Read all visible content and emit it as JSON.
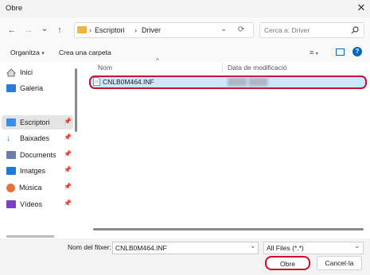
{
  "window": {
    "title": "Obre"
  },
  "nav": {
    "back": "←",
    "forward": "→",
    "recent": "⌄",
    "up": "↑",
    "breadcrumb": [
      "Escriptori",
      "Driver"
    ],
    "sep": "›",
    "refresh": "⟳",
    "search_placeholder": "Cerca a: Driver"
  },
  "toolbar": {
    "organize": "Organitza",
    "new_folder": "Crea una carpeta"
  },
  "sidebar": {
    "items": [
      {
        "label": "Inici",
        "icon": "home-icon"
      },
      {
        "label": "Galeria",
        "icon": "gallery-icon"
      },
      {
        "label": "Escriptori",
        "icon": "desktop-icon",
        "pinned": true,
        "selected": true
      },
      {
        "label": "Baixades",
        "icon": "download-icon",
        "pinned": true
      },
      {
        "label": "Documents",
        "icon": "documents-icon",
        "pinned": true
      },
      {
        "label": "Imatges",
        "icon": "pictures-icon",
        "pinned": true
      },
      {
        "label": "Música",
        "icon": "music-icon",
        "pinned": true
      },
      {
        "label": "Vídeos",
        "icon": "videos-icon",
        "pinned": true
      }
    ]
  },
  "columns": {
    "name": "Nom",
    "modified": "Data de modificació"
  },
  "files": [
    {
      "name": "CNLB0M464.INF",
      "modified": "████ ████"
    }
  ],
  "footer": {
    "filename_label": "Nom del fitxer:",
    "filename_value": "CNLB0M464.INF",
    "filter_value": "All Files (*.*)",
    "open": "Obre",
    "cancel": "Cancel·la"
  },
  "colors": {
    "selection": "#cce8ff",
    "highlight_ring": "#c8102e",
    "accent": "#0067c0"
  }
}
